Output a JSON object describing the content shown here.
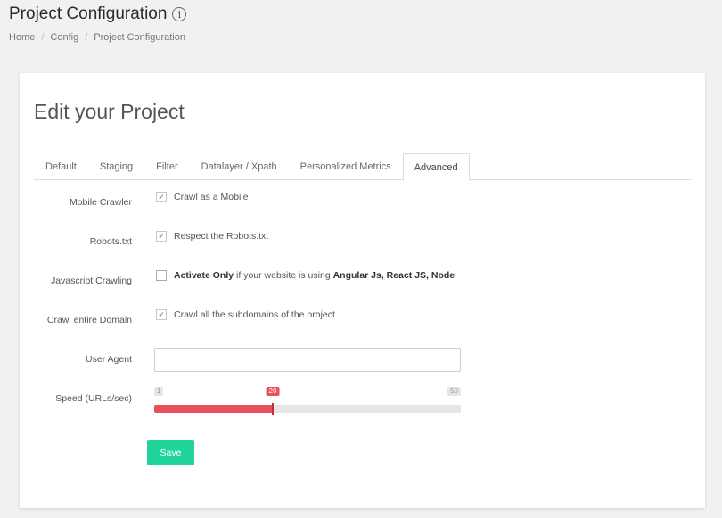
{
  "header": {
    "title": "Project Configuration",
    "info_icon": "info-icon",
    "breadcrumb": [
      "Home",
      "Config",
      "Project Configuration"
    ]
  },
  "card": {
    "title": "Edit your Project",
    "tabs": [
      "Default",
      "Staging",
      "Filter",
      "Datalayer / Xpath",
      "Personalized Metrics",
      "Advanced"
    ],
    "active_tab": "Advanced"
  },
  "form": {
    "mobile_crawler": {
      "label": "Mobile Crawler",
      "checked": true,
      "text": "Crawl as a Mobile"
    },
    "robots": {
      "label": "Robots.txt",
      "checked": true,
      "text": "Respect the Robots.txt"
    },
    "javascript": {
      "label": "Javascript Crawling",
      "checked": false,
      "text_bold": "Activate Only",
      "text_mid": " if your website is using ",
      "text_bold2": "Angular Js, React JS, Node"
    },
    "domain": {
      "label": "Crawl entire Domain",
      "checked": true,
      "text": "Crawl all the subdomains of the project."
    },
    "user_agent": {
      "label": "User Agent",
      "value": "",
      "placeholder": ""
    },
    "speed": {
      "label": "Speed (URLs/sec)",
      "min": "1",
      "max": "50",
      "value": "20"
    }
  },
  "actions": {
    "save_label": "Save"
  },
  "colors": {
    "accent_red": "#e8505b",
    "save_green": "#1fd59b"
  }
}
